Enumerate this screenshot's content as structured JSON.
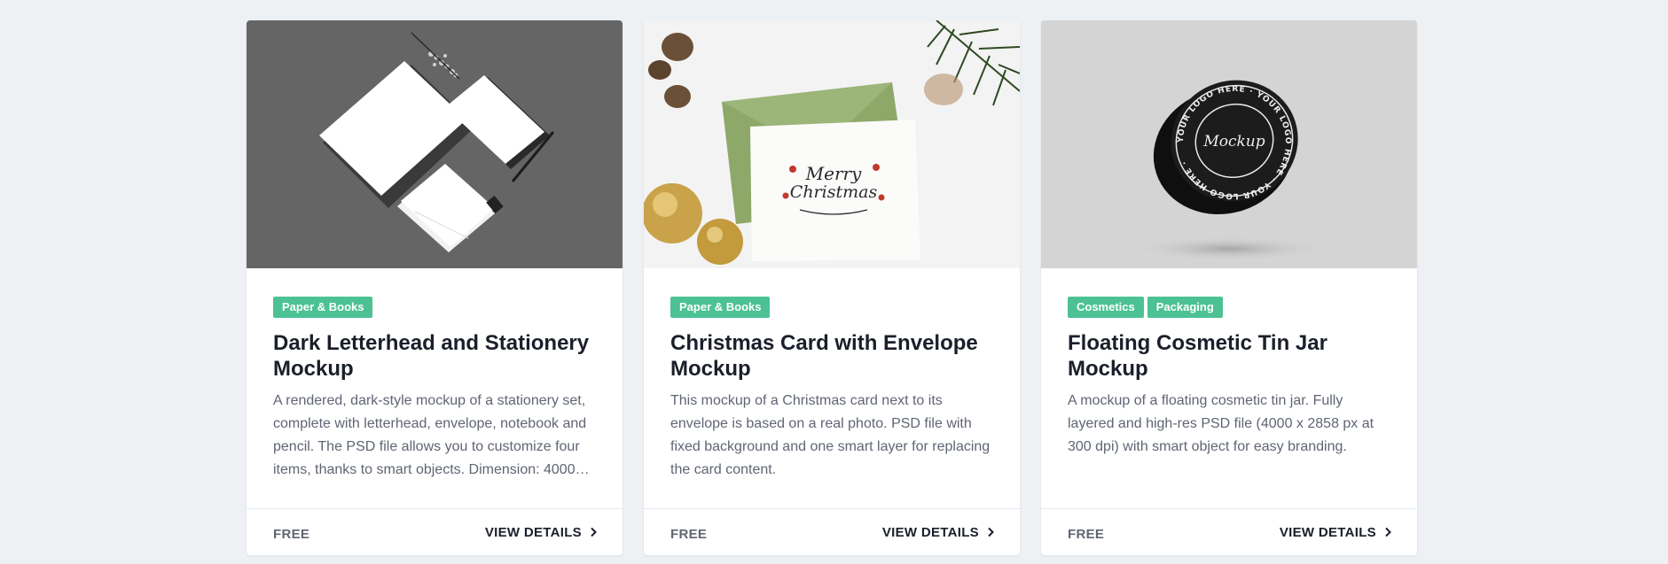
{
  "cards": [
    {
      "thumb_icon": "stationery-mockup-image",
      "tags": [
        "Paper & Books"
      ],
      "title": "Dark Letterhead and Stationery Mockup",
      "description": "A rendered, dark-style mockup of a stationery set, complete with letterhead, envelope, notebook and pencil. The PSD file allows you to customize four items, thanks to smart objects. Dimension: 4000…",
      "price": "FREE",
      "details_label": "VIEW DETAILS"
    },
    {
      "thumb_icon": "christmas-card-image",
      "card_text_line1": "Merry",
      "card_text_line2": "Christmas",
      "tags": [
        "Paper & Books"
      ],
      "title": "Christmas Card with Envelope Mockup",
      "description": "This mockup of a Christmas card next to its envelope is based on a real photo. PSD file with fixed background and one smart layer for replacing the card content.",
      "price": "FREE",
      "details_label": "VIEW DETAILS"
    },
    {
      "thumb_icon": "cosmetic-tin-jar-image",
      "jar_script": "Mockup",
      "jar_ring_text": "YOUR LOGO HERE · YOUR LOGO HERE · YOUR LOGO HERE ·",
      "tags": [
        "Cosmetics",
        "Packaging"
      ],
      "title": "Floating Cosmetic Tin Jar Mockup",
      "description": "A mockup of a floating cosmetic tin jar. Fully layered and high-res PSD file (4000 x 2858 px at 300 dpi) with smart object for easy branding.",
      "price": "FREE",
      "details_label": "VIEW DETAILS"
    }
  ],
  "colors": {
    "tag": "#4cc294",
    "background": "#eef1f4",
    "title": "#1b1f2a",
    "text": "#5f6573"
  }
}
